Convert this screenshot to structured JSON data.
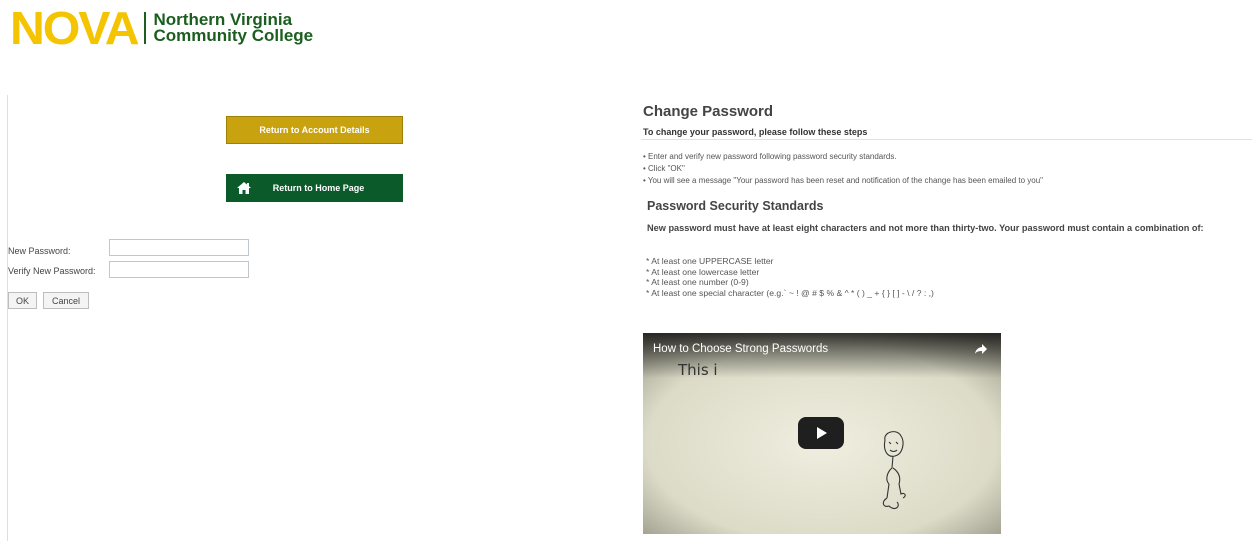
{
  "header": {
    "logo_word": "NOVA",
    "logo_line1": "Northern Virginia",
    "logo_line2": "Community College"
  },
  "buttons": {
    "account": "Return to Account Details",
    "home": "Return to Home Page"
  },
  "form": {
    "new_password_label": "New Password:",
    "verify_password_label": "Verify New Password:",
    "new_password_value": "",
    "verify_password_value": "",
    "ok_label": "OK",
    "cancel_label": "Cancel"
  },
  "instructions": {
    "title": "Change Password",
    "subtitle": "To change your password, please follow these steps",
    "steps": [
      "• Enter and verify new password following password security standards.",
      "• Click \"OK\"",
      "• You will see a message \"Your password has been reset and notification of the change has been emailed to you\""
    ]
  },
  "security": {
    "title": "Password Security Standards",
    "description": "New password must have at least eight characters and not more than thirty-two. Your password must contain a combination of:",
    "requirements": [
      "* At least one UPPERCASE letter",
      "* At least one lowercase letter",
      "* At least one number (0-9)",
      "* At least one special character (e.g.` ~ ! @ # $ % & ^ * ( ) _ + { } [ ] - \\ / ? : ,)"
    ]
  },
  "video": {
    "title": "How to Choose Strong Passwords",
    "frame_text": "This i"
  },
  "colors": {
    "nova_yellow": "#f5c400",
    "nova_green": "#1b5e20",
    "account_button": "#c9a20f",
    "home_button": "#0b5a2a"
  },
  "icons": {
    "home": "home-icon",
    "play": "play-icon",
    "share": "share-icon"
  }
}
